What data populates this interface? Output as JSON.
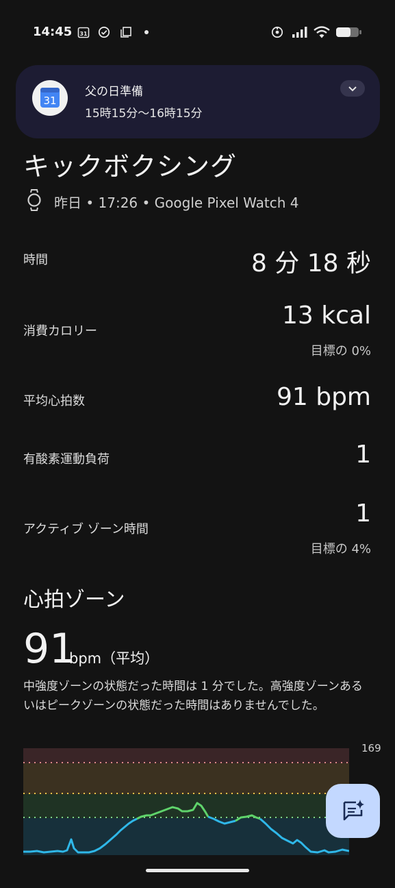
{
  "status_bar": {
    "time": "14:45",
    "calendar_day": "31",
    "icons": [
      "calendar-icon",
      "check-circle-icon",
      "copy-icon",
      "dot-icon",
      "hotspot-icon",
      "signal-icon",
      "wifi-icon",
      "battery-icon"
    ]
  },
  "notification": {
    "title": "父の日準備",
    "subtitle": "15時15分〜16時15分",
    "app_icon_day": "31",
    "icon": "calendar-icon",
    "accent": "#4285f4"
  },
  "activity": {
    "title": "キックボクシング",
    "meta": "昨日 • 17:26 • Google Pixel Watch 4"
  },
  "stats": [
    {
      "label": "時間",
      "value": "8 分 18 秒"
    },
    {
      "label": "消費カロリー",
      "value": "13 kcal",
      "goal": "目標の 0%"
    },
    {
      "label": "平均心拍数",
      "value": "91 bpm"
    },
    {
      "label": "有酸素運動負荷",
      "value": "1"
    },
    {
      "label": "アクティブ ゾーン時間",
      "value": "1",
      "goal": "目標の 4%"
    }
  ],
  "heart_zone": {
    "section_title": "心拍ゾーン",
    "avg_value": "91",
    "avg_unit": "bpm（平均）",
    "description": "中強度ゾーンの状態だった時間は 1 分でした。高強度ゾーンあるいはピークゾーンの状態だった時間はありませんでした。"
  },
  "chart_data": {
    "type": "line",
    "max_label": "169",
    "zone_colors": {
      "peak": "#3a2527",
      "high": "#3b3120",
      "moderate": "#1f3324",
      "low": "#17303b"
    },
    "line_colors": {
      "low": "#2fb7e8",
      "moderate": "#5fd36b"
    }
  },
  "fab": {
    "icon": "ai-chat-sparkle-icon"
  }
}
